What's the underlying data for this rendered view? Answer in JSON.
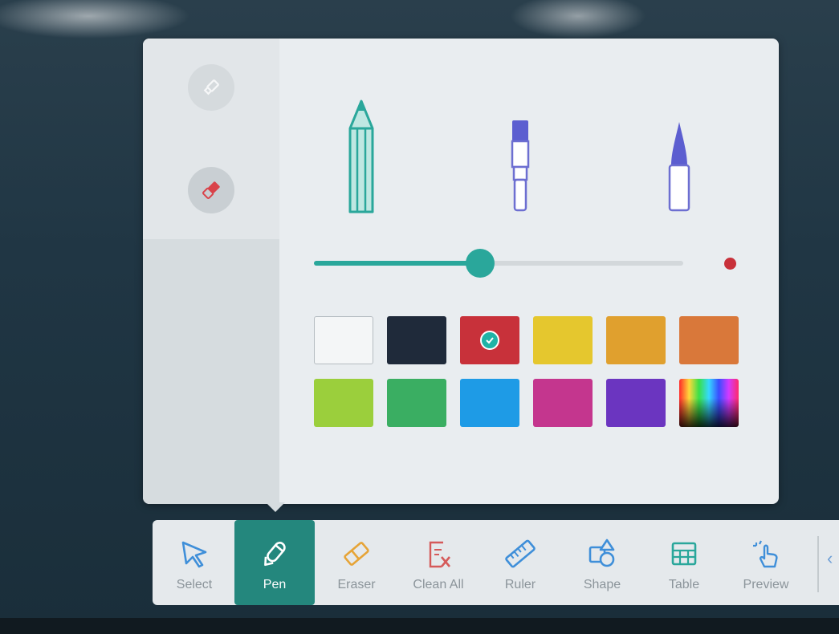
{
  "pen_panel": {
    "pen_types": [
      {
        "name": "pencil-icon",
        "color": "#2aa79b"
      },
      {
        "name": "brush-icon",
        "color": "#6d6fd1"
      },
      {
        "name": "marker-pen-icon",
        "color": "#6d6fd1"
      }
    ],
    "size_slider": {
      "value_fraction": 0.45
    },
    "selected_color": "#c8313a",
    "colors": [
      {
        "hex": "#f4f6f7",
        "selected": false
      },
      {
        "hex": "#1f2a3a",
        "selected": false
      },
      {
        "hex": "#c8313a",
        "selected": true
      },
      {
        "hex": "#e5c72e",
        "selected": false
      },
      {
        "hex": "#e0a02e",
        "selected": false
      },
      {
        "hex": "#d9783a",
        "selected": false
      },
      {
        "hex": "#9bcf3c",
        "selected": false
      },
      {
        "hex": "#3aae62",
        "selected": false
      },
      {
        "hex": "#1e9be6",
        "selected": false
      },
      {
        "hex": "#c4368e",
        "selected": false
      },
      {
        "hex": "#6b35c0",
        "selected": false
      },
      {
        "hex": "spectrum",
        "selected": false
      }
    ]
  },
  "toolbar": {
    "tools": [
      {
        "label": "Select",
        "icon": "cursor-icon"
      },
      {
        "label": "Pen",
        "icon": "pen-icon",
        "active": true
      },
      {
        "label": "Eraser",
        "icon": "eraser-icon"
      },
      {
        "label": "Clean All",
        "icon": "clean-all-icon"
      },
      {
        "label": "Ruler",
        "icon": "ruler-icon"
      },
      {
        "label": "Shape",
        "icon": "shape-icon"
      },
      {
        "label": "Table",
        "icon": "table-icon"
      },
      {
        "label": "Preview",
        "icon": "preview-hand-icon"
      }
    ]
  },
  "colors": {
    "accent": "#2aa79b",
    "toolbar_active": "#24877d",
    "icon_blue": "#3f8fd9",
    "icon_orange": "#e6a437",
    "icon_red": "#d55a5a"
  }
}
